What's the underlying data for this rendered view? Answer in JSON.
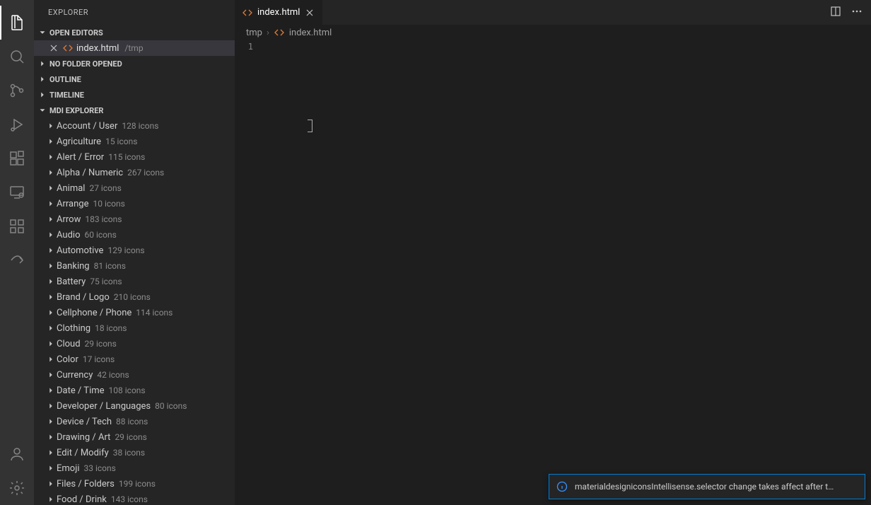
{
  "sidebar": {
    "title": "EXPLORER",
    "sections": {
      "open_editors": "OPEN EDITORS",
      "no_folder": "NO FOLDER OPENED",
      "outline": "OUTLINE",
      "timeline": "TIMELINE",
      "mdi": "MDI EXPLORER"
    },
    "open_editor": {
      "filename": "index.html",
      "dir": "/tmp"
    }
  },
  "mdi_categories": [
    {
      "name": "Account / User",
      "count": "128 icons"
    },
    {
      "name": "Agriculture",
      "count": "15 icons"
    },
    {
      "name": "Alert / Error",
      "count": "115 icons"
    },
    {
      "name": "Alpha / Numeric",
      "count": "267 icons"
    },
    {
      "name": "Animal",
      "count": "27 icons"
    },
    {
      "name": "Arrange",
      "count": "10 icons"
    },
    {
      "name": "Arrow",
      "count": "183 icons"
    },
    {
      "name": "Audio",
      "count": "60 icons"
    },
    {
      "name": "Automotive",
      "count": "129 icons"
    },
    {
      "name": "Banking",
      "count": "81 icons"
    },
    {
      "name": "Battery",
      "count": "75 icons"
    },
    {
      "name": "Brand / Logo",
      "count": "210 icons"
    },
    {
      "name": "Cellphone / Phone",
      "count": "114 icons"
    },
    {
      "name": "Clothing",
      "count": "18 icons"
    },
    {
      "name": "Cloud",
      "count": "29 icons"
    },
    {
      "name": "Color",
      "count": "17 icons"
    },
    {
      "name": "Currency",
      "count": "42 icons"
    },
    {
      "name": "Date / Time",
      "count": "108 icons"
    },
    {
      "name": "Developer / Languages",
      "count": "80 icons"
    },
    {
      "name": "Device / Tech",
      "count": "88 icons"
    },
    {
      "name": "Drawing / Art",
      "count": "29 icons"
    },
    {
      "name": "Edit / Modify",
      "count": "38 icons"
    },
    {
      "name": "Emoji",
      "count": "33 icons"
    },
    {
      "name": "Files / Folders",
      "count": "199 icons"
    },
    {
      "name": "Food / Drink",
      "count": "143 icons"
    }
  ],
  "tab": {
    "filename": "index.html"
  },
  "breadcrumb": {
    "dir": "tmp",
    "file": "index.html"
  },
  "editor": {
    "line1": "1"
  },
  "toast": {
    "message": "materialdesigniconsIntellisense.selector change takes affect after t…"
  }
}
